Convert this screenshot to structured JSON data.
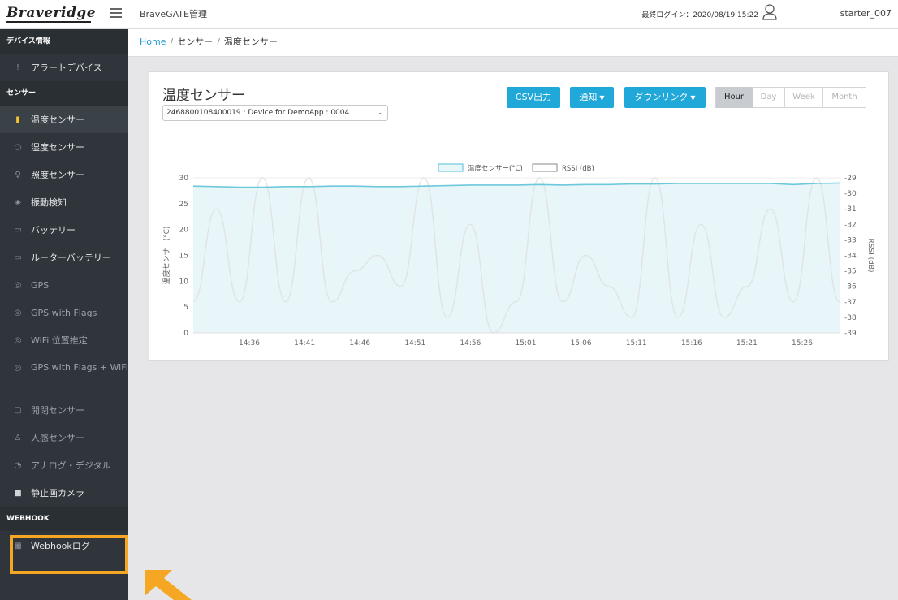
{
  "header": {
    "logo": "Braveridge",
    "app_title": "BraveGATE管理",
    "last_login": "最終ログイン：2020/08/19 15:22",
    "username": "starter_007"
  },
  "sidebar": {
    "section_device": "デバイス情報",
    "alert_devices": "アラートデバイス",
    "section_sensor": "センサー",
    "items": [
      {
        "label": "温度センサー",
        "icon": "thermometer-icon"
      },
      {
        "label": "湿度センサー",
        "icon": "droplet-icon"
      },
      {
        "label": "照度センサー",
        "icon": "lightbulb-icon"
      },
      {
        "label": "振動検知",
        "icon": "layers-icon"
      },
      {
        "label": "バッテリー",
        "icon": "battery-icon"
      },
      {
        "label": "ルーターバッテリー",
        "icon": "battery-icon"
      },
      {
        "label": "GPS",
        "icon": "location-pin-icon"
      },
      {
        "label": "GPS with Flags",
        "icon": "location-pin-icon"
      },
      {
        "label": "WiFi 位置推定",
        "icon": "location-pin-icon"
      },
      {
        "label": "GPS with Flags + WiFi",
        "icon": "location-pin-icon"
      },
      {
        "label": "開閉センサー",
        "icon": "door-icon"
      },
      {
        "label": "人感センサー",
        "icon": "person-icon"
      },
      {
        "label": "アナログ・デジタル",
        "icon": "gauge-icon"
      },
      {
        "label": "静止画カメラ",
        "icon": "camera-icon"
      }
    ],
    "section_webhook": "WEBHOOK",
    "webhook_log": "Webhookログ"
  },
  "breadcrumb": {
    "home": "Home",
    "sensor": "センサー",
    "current": "温度センサー"
  },
  "card": {
    "title": "温度センサー",
    "device_select": "2468800108400019 : Device for DemoApp : 0004",
    "csv_button": "CSV出力",
    "notify_button": "通知",
    "downlink_button": "ダウンリンク",
    "ranges": [
      "Hour",
      "Day",
      "Week",
      "Month"
    ],
    "selected_range": "Hour"
  },
  "chart_data": {
    "type": "line",
    "legend": [
      "温度センサー(°C)",
      "RSSI (dB)"
    ],
    "ylabel_left": "温度センサー(°C)",
    "ylabel_right": "RSSI (dB)",
    "y_left_ticks": [
      0,
      5,
      10,
      15,
      20,
      25,
      30
    ],
    "y_right_ticks": [
      -29,
      -30,
      -31,
      -32,
      -33,
      -34,
      -35,
      -36,
      -37,
      -38,
      -39
    ],
    "x_ticks": [
      "14:36",
      "14:41",
      "14:46",
      "14:51",
      "14:56",
      "15:01",
      "15:06",
      "15:11",
      "15:16",
      "15:21",
      "15:26"
    ],
    "ylim_left": [
      0,
      30
    ],
    "ylim_right": [
      -39,
      -29
    ],
    "series": [
      {
        "name": "温度センサー(°C)",
        "color": "#6cc9db",
        "values": [
          28.4,
          28.3,
          28.2,
          28.2,
          28.3,
          28.3,
          28.4,
          28.4,
          28.3,
          28.3,
          28.4,
          28.5,
          28.6,
          28.6,
          28.6,
          28.7,
          28.6,
          28.7,
          28.7,
          28.8,
          28.8,
          28.9,
          28.9,
          28.9,
          28.9,
          28.9,
          28.7,
          28.9,
          29.0
        ]
      },
      {
        "name": "RSSI (dB)",
        "color": "#e0e4e6",
        "values": [
          -37,
          -31,
          -37,
          -29,
          -37,
          -29,
          -37,
          -35,
          -34,
          -36,
          -29,
          -38,
          -32,
          -39,
          -37,
          -29,
          -37,
          -34,
          -36,
          -38,
          -29,
          -38,
          -32,
          -38,
          -36,
          -31,
          -37,
          -29,
          -37
        ]
      }
    ]
  }
}
